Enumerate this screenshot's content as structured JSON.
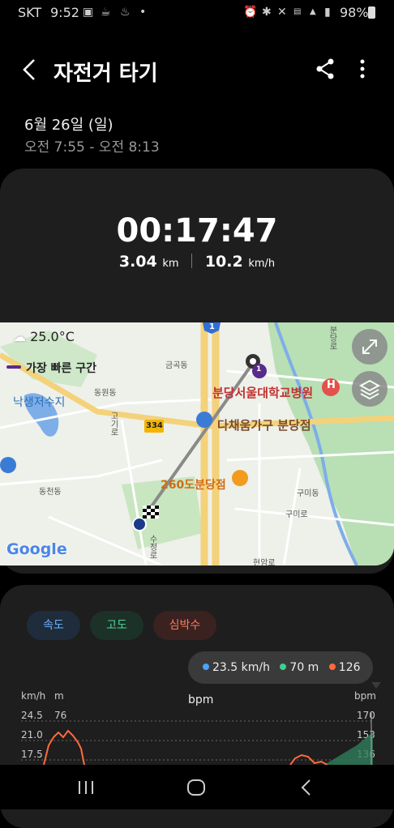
{
  "status_bar": {
    "carrier": "SKT",
    "time": "9:52",
    "battery": "98%"
  },
  "header": {
    "title": "자전거 타기",
    "back_icon": "back-arrow-icon",
    "share_icon": "share-icon",
    "more_icon": "more-vert-icon"
  },
  "session": {
    "date": "6월 26일 (일)",
    "time_range": "오전 7:55 - 오전 8:13"
  },
  "summary": {
    "duration": "00:17:47",
    "distance": "3.04",
    "distance_unit": "km",
    "speed": "10.2",
    "speed_unit": "km/h"
  },
  "map": {
    "temperature": "25.0°C",
    "legend_label": "가장 빠른 구간",
    "segment_marker": "1",
    "attribution": "Google",
    "labels": {
      "geumgok": "금곡동",
      "dongwon": "동원동",
      "lake": "낙생저수지",
      "dongcheon": "동천동",
      "hospital": "분당서울대학교병원",
      "furniture": "다채움가구 분당점",
      "poi260": "260도분당점",
      "gumi": "구미동",
      "gumiro": "구미로",
      "road334": "334",
      "road1": "1",
      "hyeonam": "현암로",
      "sujeong": "수정로",
      "gogiro": "고기로",
      "bundang_road": "분당로"
    },
    "colors": {
      "route": "#8a8a8a",
      "fastest": "#5a2a8c",
      "park": "#b9dfb5",
      "highway": "#f4d27a",
      "water": "#7eaee8"
    }
  },
  "chart": {
    "tabs": [
      "속도",
      "고도",
      "심박수"
    ],
    "tooltip": {
      "speed": "23.5 km/h",
      "altitude": "70 m",
      "heart_rate": "126 bpm"
    },
    "axes": {
      "speed_unit": "km/h",
      "alt_unit": "m",
      "hr_unit": "bpm",
      "speed_ticks": [
        "24.5",
        "21.0",
        "17.5"
      ],
      "alt_ticks": [
        "76"
      ],
      "hr_ticks": [
        "170",
        "153",
        "136"
      ]
    },
    "colors": {
      "speed": "#4aa3ff",
      "altitude": "#3ecf8e",
      "heart_rate": "#ff6a3d"
    }
  }
}
